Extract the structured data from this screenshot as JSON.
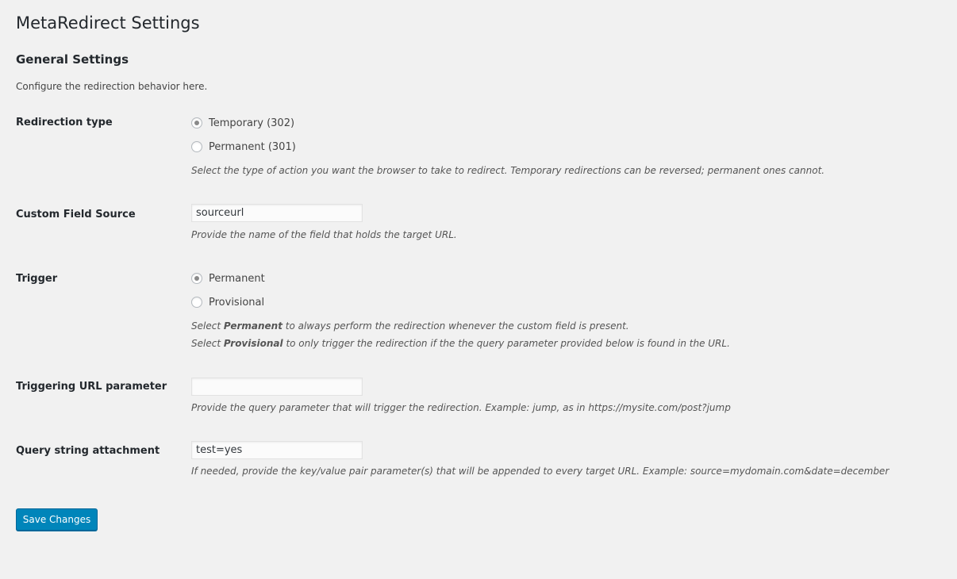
{
  "page": {
    "title": "MetaRedirect Settings"
  },
  "section": {
    "title": "General Settings",
    "description": "Configure the redirection behavior here."
  },
  "redirection_type": {
    "label": "Redirection type",
    "options": [
      {
        "label": "Temporary (302)",
        "checked": true
      },
      {
        "label": "Permanent (301)",
        "checked": false
      }
    ],
    "description": "Select the type of action you want the browser to take to redirect. Temporary redirections can be reversed; permanent ones cannot."
  },
  "custom_field_source": {
    "label": "Custom Field Source",
    "value": "sourceurl",
    "description": "Provide the name of the field that holds the target URL."
  },
  "trigger": {
    "label": "Trigger",
    "options": [
      {
        "label": "Permanent",
        "checked": true
      },
      {
        "label": "Provisional",
        "checked": false
      }
    ],
    "description_line1": {
      "prefix": "Select ",
      "bold": "Permanent",
      "suffix": " to always perform the redirection whenever the custom field is present."
    },
    "description_line2": {
      "prefix": "Select ",
      "bold": "Provisional",
      "suffix": " to only trigger the redirection if the the query parameter provided below is found in the URL."
    }
  },
  "triggering_url_parameter": {
    "label": "Triggering URL parameter",
    "value": "",
    "description": "Provide the query parameter that will trigger the redirection. Example: jump, as in https://mysite.com/post?jump"
  },
  "query_string_attachment": {
    "label": "Query string attachment",
    "value": "test=yes",
    "description": "If needed, provide the key/value pair parameter(s) that will be appended to every target URL. Example: source=mydomain.com&date=december"
  },
  "actions": {
    "save_label": "Save Changes"
  },
  "colors": {
    "background": "#f1f1f1",
    "primary_button": "#0085ba",
    "text": "#23282d"
  }
}
